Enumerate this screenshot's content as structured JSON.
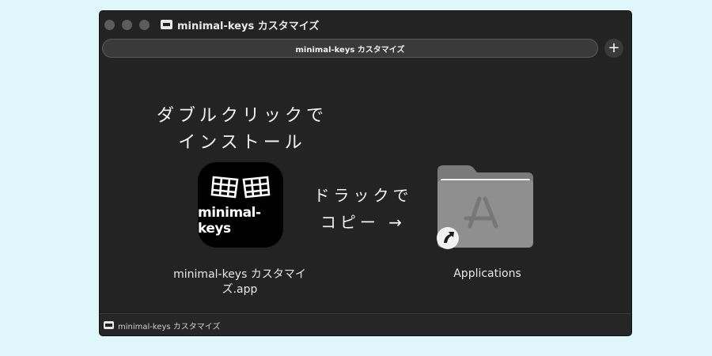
{
  "window": {
    "title": "minimal-keys カスタマイズ",
    "tab_label": "minimal-keys カスタマイズ",
    "add_tab_symbol": "+"
  },
  "instructions": {
    "double_click": "ダブルクリックで\nインストール",
    "drag_copy": "ドラックで\nコピー →"
  },
  "app": {
    "logo_text": "minimal-keys",
    "filename": "minimal-keys カスタマイズ.app"
  },
  "applications": {
    "label": "Applications"
  },
  "statusbar": {
    "label": "minimal-keys カスタマイズ"
  },
  "colors": {
    "background": "#dff6fa",
    "window": "#232323",
    "folder": "#8a8a8a"
  }
}
